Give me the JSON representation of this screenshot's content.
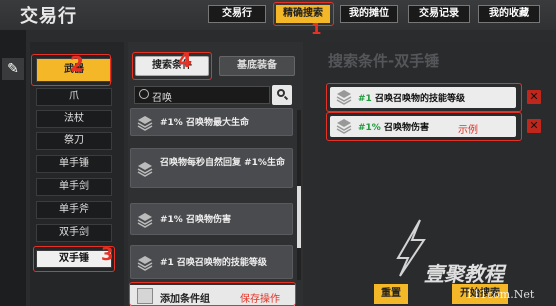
{
  "app": {
    "title": "交易行"
  },
  "tabs": [
    {
      "label": "交易行"
    },
    {
      "label": "精确搜索"
    },
    {
      "label": "我的摊位"
    },
    {
      "label": "交易记录"
    },
    {
      "label": "我的收藏"
    }
  ],
  "categories": [
    {
      "label": "武器"
    },
    {
      "label": "爪"
    },
    {
      "label": "法杖"
    },
    {
      "label": "祭刀"
    },
    {
      "label": "单手锤"
    },
    {
      "label": "单手剑"
    },
    {
      "label": "单手斧"
    },
    {
      "label": "双手剑"
    },
    {
      "label": "双手锤"
    }
  ],
  "filter_buttons": {
    "search_conditions": "搜索条件",
    "base_equipment": "基底装备"
  },
  "search": {
    "value": "召唤"
  },
  "results": [
    {
      "text": "#1% 召唤物最大生命"
    },
    {
      "text": "召唤物每秒自然回复 #1%生命"
    },
    {
      "text": "#1% 召唤物伤害"
    },
    {
      "text": "#1 召唤召唤物的技能等级"
    }
  ],
  "add_group": {
    "label": "添加条件组",
    "annotation": "保存操作"
  },
  "right_panel": {
    "title": "搜索条件-双手锤",
    "conditions": [
      {
        "prefix": "#1",
        "text": "召唤召唤物的技能等级"
      },
      {
        "prefix": "#1%",
        "text": "召唤物伤害",
        "annotation": "示例"
      }
    ],
    "reset_label": "重置",
    "search_label": "开始搜索"
  },
  "annotations": {
    "n1": "1",
    "n2": "2",
    "n3": "3",
    "n4": "4"
  },
  "watermark": {
    "brand": "壹聚教程",
    "url": "111com.Net"
  },
  "colors": {
    "accent": "#f3b728",
    "annotation": "#e53225",
    "delete": "#c0271c",
    "condition_prefix": "#1f9b3d"
  },
  "icons": {
    "edit": "pencil-icon",
    "search": "search-icon",
    "delete": "close-icon",
    "item": "stack-icon"
  }
}
